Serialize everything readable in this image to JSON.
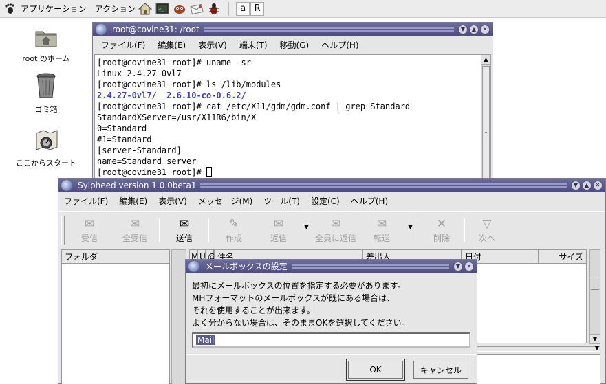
{
  "panel": {
    "menus": [
      "アプリケーション",
      "アクション"
    ],
    "launchers": [
      "home-launcher-icon",
      "terminal-launcher-icon",
      "gimp-launcher-icon",
      "mail-launcher-icon",
      "bug-launcher-icon"
    ],
    "app_buttons": [
      "a",
      "R"
    ]
  },
  "desktop": {
    "icons": [
      {
        "name": "folder-home-icon",
        "label": "root のホーム"
      },
      {
        "name": "trash-icon",
        "label": "ゴミ箱"
      },
      {
        "name": "start-here-icon",
        "label": "ここからスタート"
      }
    ]
  },
  "terminal": {
    "title": "root@covine31: /root",
    "menu": [
      "ファイル(F)",
      "編集(E)",
      "表示(V)",
      "端末(T)",
      "移動(G)",
      "ヘルプ(H)"
    ],
    "lines": [
      "[root@covine31 root]# uname -sr",
      "Linux 2.4.27-0vl7",
      "[root@covine31 root]# ls /lib/modules",
      "2.4.27-0vl7/  2.6.10-co-0.6.2/",
      "[root@covine31 root]# cat /etc/X11/gdm/gdm.conf | grep Standard",
      "StandardXServer=/usr/X11R6/bin/X",
      "0=Standard",
      "#1=Standard",
      "[server-Standard]",
      "name=Standard server",
      "[root@covine31 root]# "
    ]
  },
  "sylpheed": {
    "title": "Sylpheed version 1.0.0beta1",
    "menu": [
      "ファイル(F)",
      "編集(E)",
      "表示(V)",
      "メッセージ(M)",
      "ツール(T)",
      "設定(C)",
      "ヘルプ(H)"
    ],
    "toolbar": [
      {
        "label": "受信",
        "icon": "receive-icon"
      },
      {
        "label": "全受信",
        "icon": "receive-all-icon"
      },
      {
        "label": "送信",
        "icon": "send-icon"
      },
      {
        "label": "作成",
        "icon": "compose-icon"
      },
      {
        "label": "返信",
        "icon": "reply-icon"
      },
      {
        "label": "全員に返信",
        "icon": "reply-all-icon"
      },
      {
        "label": "転送",
        "icon": "forward-icon"
      },
      {
        "label": "削除",
        "icon": "delete-icon"
      },
      {
        "label": "次へ",
        "icon": "next-icon"
      }
    ],
    "folder_header": "フォルダ",
    "columns": [
      "M",
      "U",
      "@",
      "件名",
      "差出人",
      "日付",
      "サイズ"
    ]
  },
  "dialog": {
    "title": "メールボックスの設定",
    "message": [
      "最初にメールボックスの位置を指定する必要があります。",
      "MHフォーマットのメールボックスが既にある場合は、",
      "それを使用することが出来ます。",
      "よく分からない場合は、そのままOKを選択してください。"
    ],
    "input_value": "Mail",
    "ok_label": "OK",
    "cancel_label": "キャンセル"
  }
}
